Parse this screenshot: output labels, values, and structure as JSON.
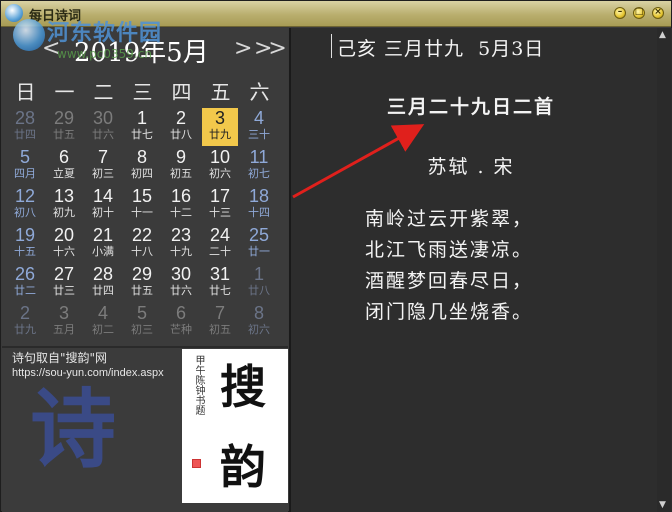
{
  "window": {
    "title": "每日诗词",
    "minimize_glyph": "–",
    "restore_glyph": "□",
    "close_glyph": "×"
  },
  "watermark": {
    "text": "河东软件园",
    "url": "www.pc0359.cn"
  },
  "calendar": {
    "month_title": "2019年5月",
    "prev_glyph": "<",
    "next_glyph": ">",
    "next_year_glyph": ">>",
    "weekdays": [
      "日",
      "一",
      "二",
      "三",
      "四",
      "五",
      "六"
    ],
    "weeks": [
      [
        {
          "d": "28",
          "l": "廿四",
          "other": true
        },
        {
          "d": "29",
          "l": "廿五",
          "other": true
        },
        {
          "d": "30",
          "l": "廿六",
          "other": true
        },
        {
          "d": "1",
          "l": "廿七"
        },
        {
          "d": "2",
          "l": "廿八"
        },
        {
          "d": "3",
          "l": "廿九",
          "today": true
        },
        {
          "d": "4",
          "l": "三十"
        }
      ],
      [
        {
          "d": "5",
          "l": "四月"
        },
        {
          "d": "6",
          "l": "立夏"
        },
        {
          "d": "7",
          "l": "初三"
        },
        {
          "d": "8",
          "l": "初四"
        },
        {
          "d": "9",
          "l": "初五"
        },
        {
          "d": "10",
          "l": "初六"
        },
        {
          "d": "11",
          "l": "初七"
        }
      ],
      [
        {
          "d": "12",
          "l": "初八"
        },
        {
          "d": "13",
          "l": "初九"
        },
        {
          "d": "14",
          "l": "初十"
        },
        {
          "d": "15",
          "l": "十一"
        },
        {
          "d": "16",
          "l": "十二"
        },
        {
          "d": "17",
          "l": "十三"
        },
        {
          "d": "18",
          "l": "十四"
        }
      ],
      [
        {
          "d": "19",
          "l": "十五"
        },
        {
          "d": "20",
          "l": "十六"
        },
        {
          "d": "21",
          "l": "小满"
        },
        {
          "d": "22",
          "l": "十八"
        },
        {
          "d": "23",
          "l": "十九"
        },
        {
          "d": "24",
          "l": "二十"
        },
        {
          "d": "25",
          "l": "廿一"
        }
      ],
      [
        {
          "d": "26",
          "l": "廿二"
        },
        {
          "d": "27",
          "l": "廿三"
        },
        {
          "d": "28",
          "l": "廿四"
        },
        {
          "d": "29",
          "l": "廿五"
        },
        {
          "d": "30",
          "l": "廿六"
        },
        {
          "d": "31",
          "l": "廿七"
        },
        {
          "d": "1",
          "l": "廿八",
          "other": true
        }
      ],
      [
        {
          "d": "2",
          "l": "廿九",
          "other": true
        },
        {
          "d": "3",
          "l": "五月",
          "other": true
        },
        {
          "d": "4",
          "l": "初二",
          "other": true
        },
        {
          "d": "5",
          "l": "初三",
          "other": true
        },
        {
          "d": "6",
          "l": "芒种",
          "other": true
        },
        {
          "d": "7",
          "l": "初五",
          "other": true
        },
        {
          "d": "8",
          "l": "初六",
          "other": true
        }
      ]
    ]
  },
  "credit": {
    "line1": "诗句取自\"搜韵\"网",
    "url": "https://sou-yun.com/index.aspx"
  },
  "logo": {
    "big_char": "诗",
    "callig_char1": "搜",
    "callig_char2": "韵"
  },
  "poem": {
    "date_line": "己亥 三月廿九  5月3日",
    "title": "三月二十九日二首",
    "author": "苏轼 . 宋",
    "lines": [
      "南岭过云开紫翠，",
      "北江飞雨送凄凉。",
      "酒醒梦回春尽日，",
      "闭门隐几坐烧香。"
    ]
  },
  "scrollbar": {
    "up_glyph": "▲",
    "down_glyph": "▼"
  },
  "colors": {
    "today_highlight": "#f2c84b",
    "weekend_text": "#8fa9d8",
    "annotation_arrow": "#e0201c"
  }
}
